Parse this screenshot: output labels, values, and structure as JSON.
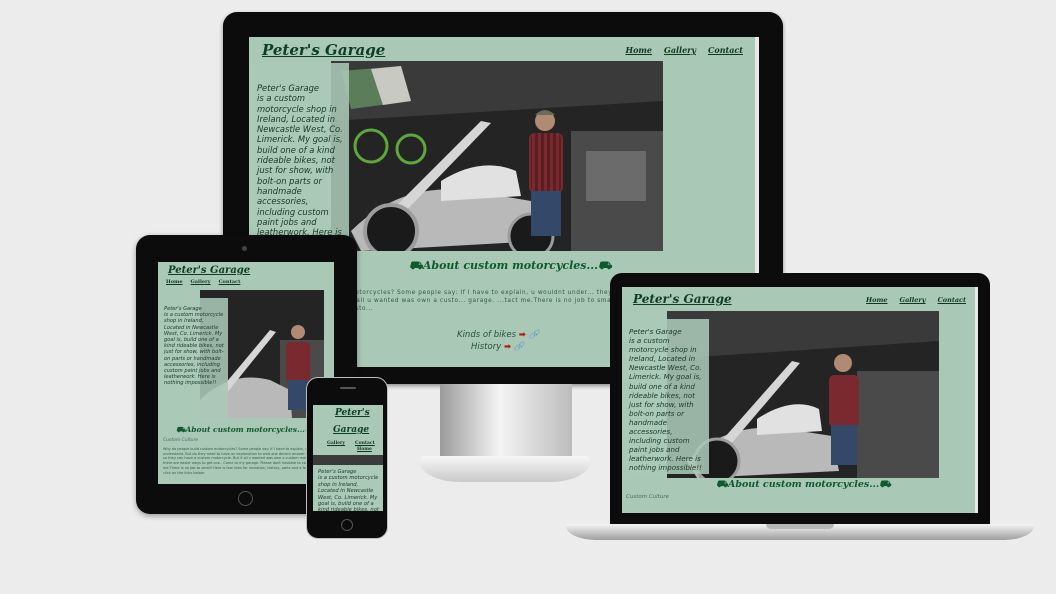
{
  "site": {
    "title": "Peter's Garage",
    "nav": [
      "Home",
      "Gallery",
      "Contact"
    ],
    "aside_title": "Peter's Garage",
    "aside_text": " is a custom motorcycle shop in Ireland, Located in Newcastle West, Co. Limerick. My goal is, build one of a kind rideable bikes, not just for show, with bolt-on parts or handmade accessories, including custom paint jobs and leatherwork. Here is nothing impossible!!",
    "about_heading": "About custom motorcycles...",
    "about_desktop": "motorcycles? Some people say: If I have to explain, u wouldnt under... they can have a custom motorcycle. But if all u wanted was own a custo... garage. ...tact me.There is no job to small! Here is few links for insiration, histo...",
    "about_tablet": "Why do people build custom motorcycles? Some people say: If I have to explain, u wouldnt understand. But do they need to have an explanation to wait one decent answer: They do it so they can have a custom motorcycle. But if all u wanted was own a custom motorcycle there are easier ways to get one.. Come to my garage. Please dont hesitate to contact me.There is no job to small! Here is few links for insiration, history, parts and a few other, just click on the links below:",
    "links": [
      "Kinds of bikes",
      "History"
    ],
    "culture": "Custom Culture"
  },
  "phone": {
    "title_line1": "Peter's",
    "title_line2": "Garage"
  },
  "colors": {
    "page_bg": "#aac8b6",
    "heading": "#0d3d22",
    "link_arrow": "#c0141a"
  }
}
